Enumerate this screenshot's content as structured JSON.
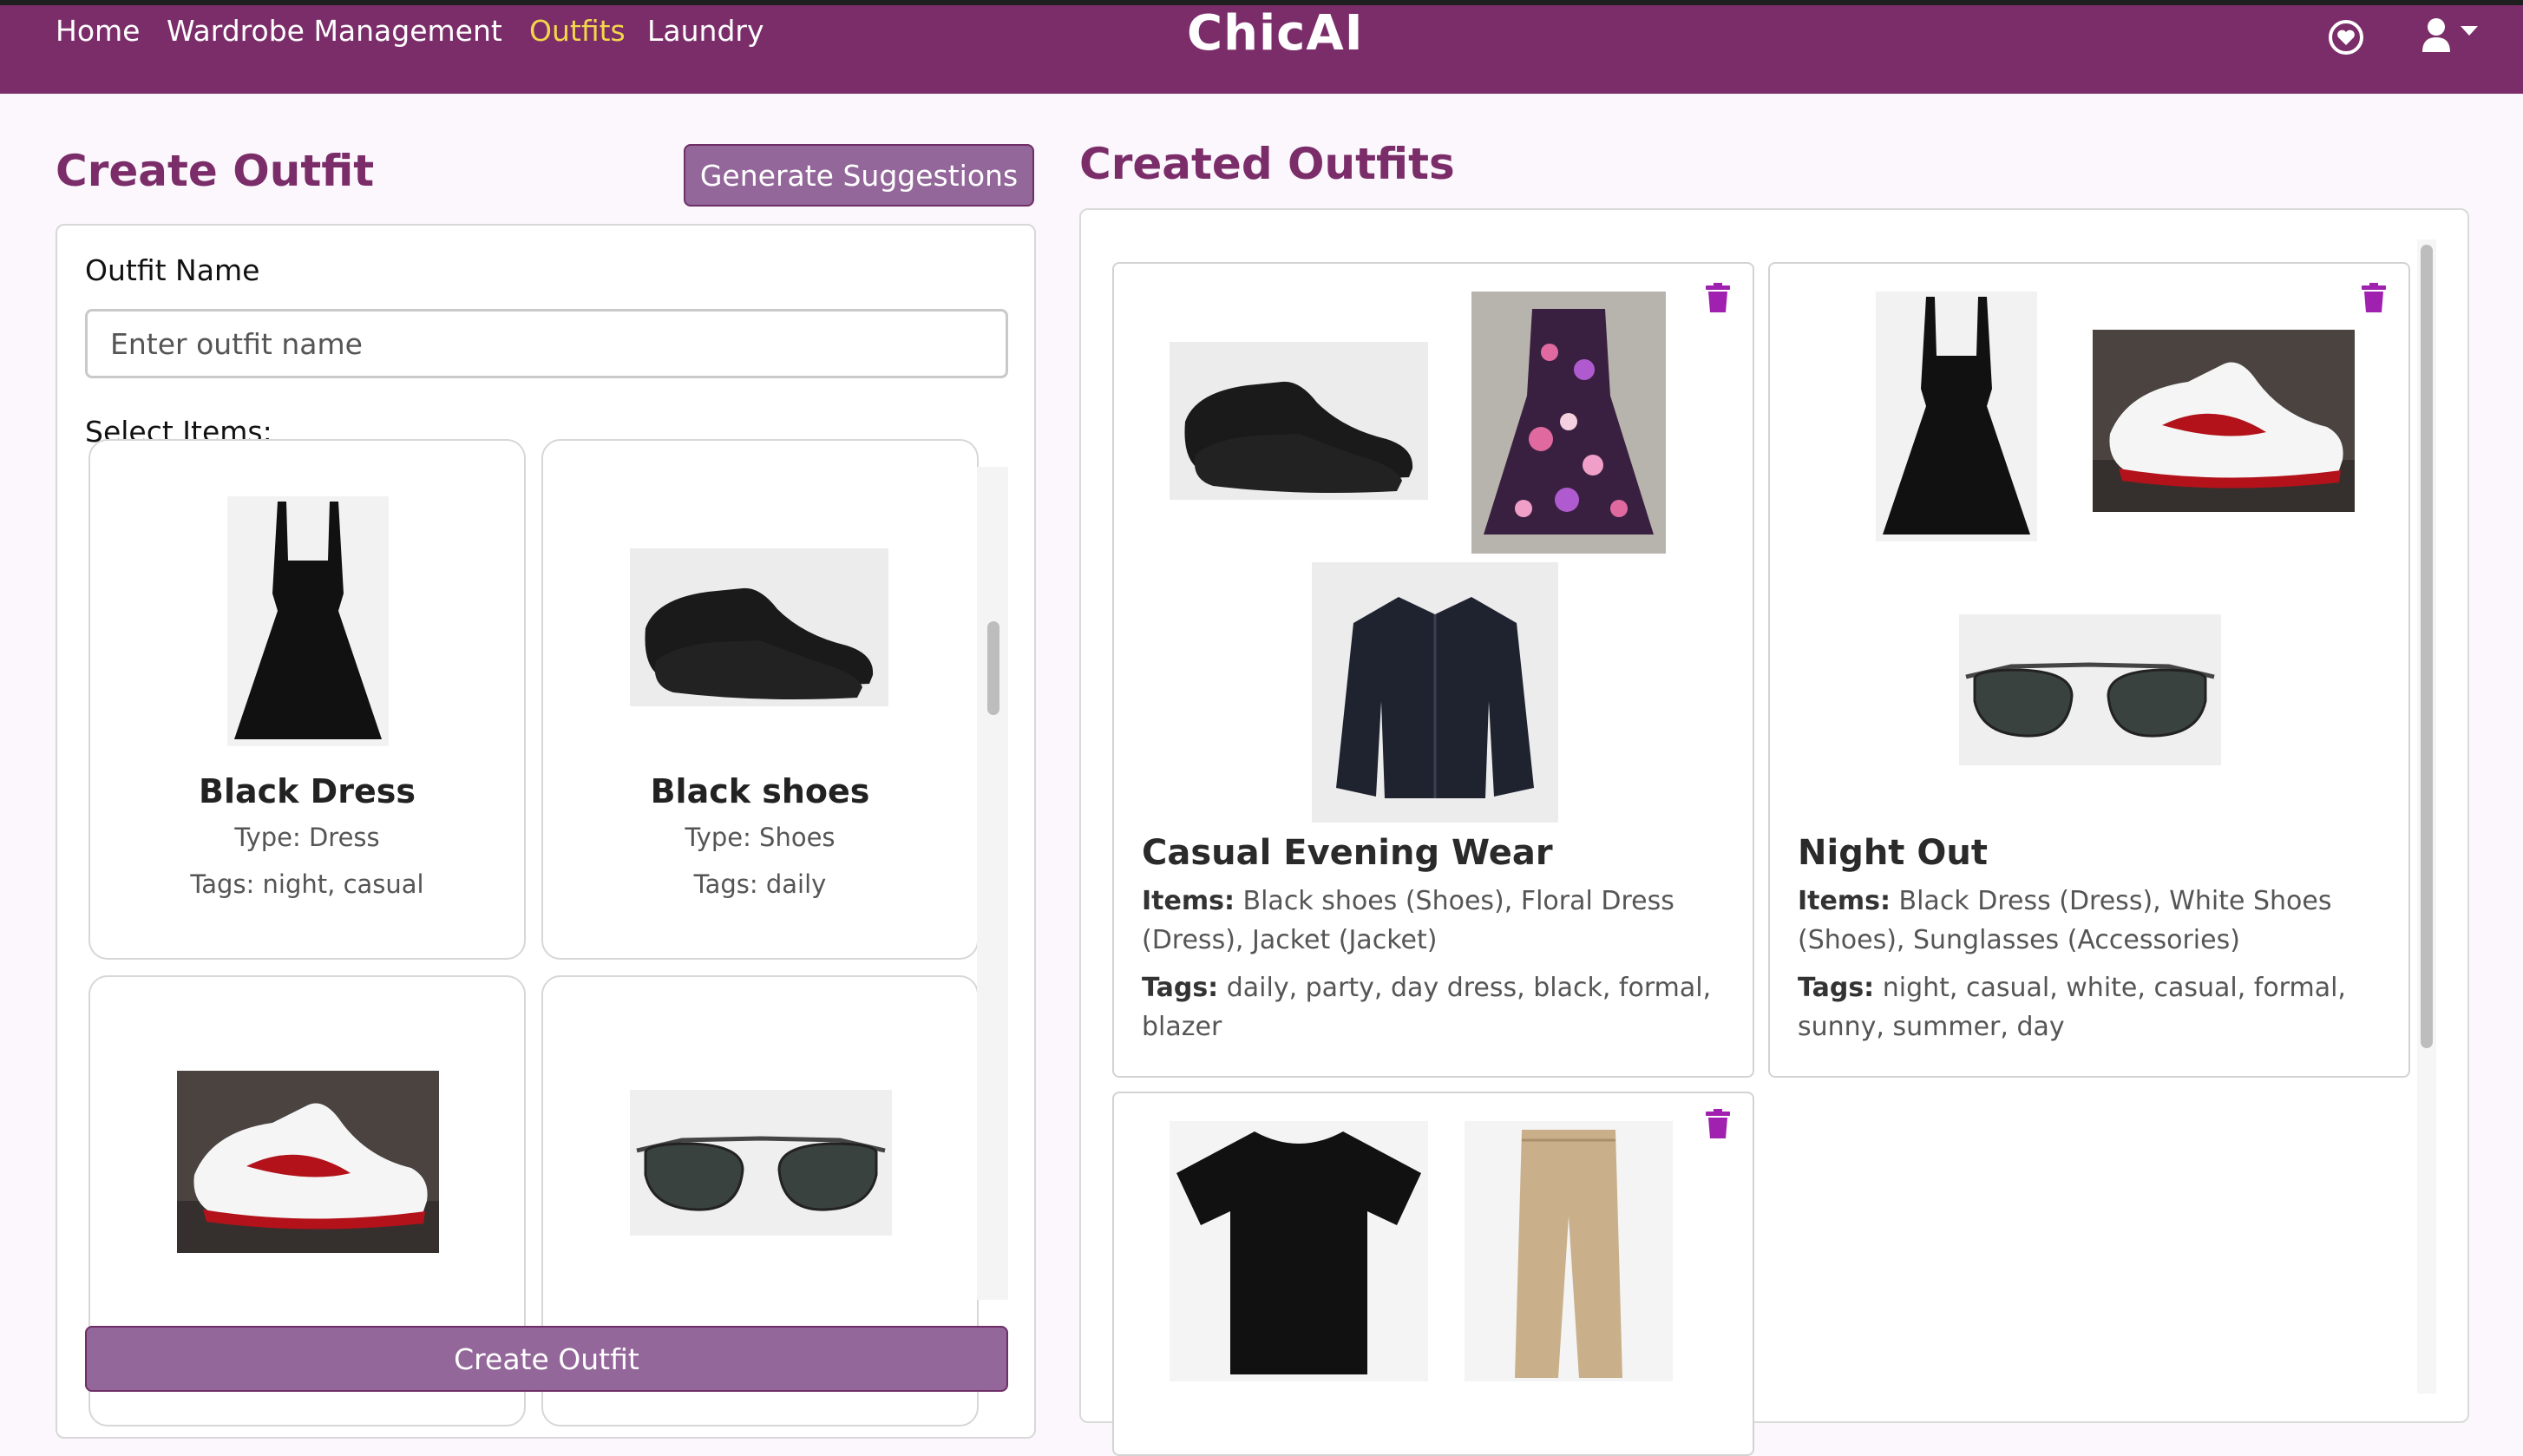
{
  "nav": {
    "links": [
      "Home",
      "Wardrobe Management",
      "Outfits",
      "Laundry"
    ],
    "active": "Outfits",
    "brand": "ChicAI",
    "icons": [
      "heart-icon",
      "user-icon",
      "caret-down-icon"
    ]
  },
  "create": {
    "title": "Create Outfit",
    "generate_label": "Generate Suggestions",
    "name_label": "Outfit Name",
    "name_placeholder": "Enter outfit name",
    "name_value": "",
    "select_label": "Select Items:",
    "items": [
      {
        "name": "Black Dress",
        "type": "Type: Dress",
        "tags": "Tags: night, casual"
      },
      {
        "name": "Black shoes",
        "type": "Type: Shoes",
        "tags": "Tags: daily"
      },
      {
        "name": "",
        "type": "",
        "tags": ""
      },
      {
        "name": "",
        "type": "",
        "tags": ""
      }
    ],
    "create_label": "Create Outfit"
  },
  "created": {
    "title": "Created Outfits",
    "items_label": "Items:",
    "tags_label": "Tags:",
    "outfits": [
      {
        "name": "Casual Evening Wear",
        "items": "Black shoes (Shoes), Floral Dress (Dress), Jacket (Jacket)",
        "tags": "daily, party, day dress, black, formal, blazer"
      },
      {
        "name": "Night Out",
        "items": "Black Dress (Dress), White Shoes (Shoes), Sunglasses (Accessories)",
        "tags": "night, casual, white, casual, formal, sunny, summer, day"
      },
      {
        "name": "",
        "items": "",
        "tags": ""
      }
    ]
  },
  "colors": {
    "brand": "#7b2d6a",
    "nav_active": "#f3d64a",
    "button": "#94679b",
    "trash": "#a020b0"
  }
}
